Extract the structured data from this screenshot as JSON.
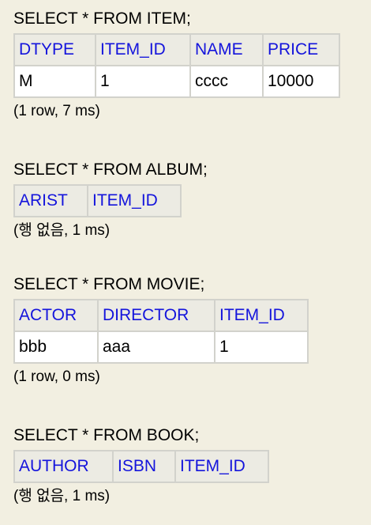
{
  "queries": [
    {
      "sql": "SELECT * FROM ITEM;",
      "columns": [
        "DTYPE",
        "ITEM_ID",
        "NAME",
        "PRICE"
      ],
      "rows": [
        [
          "M",
          "1",
          "cccc",
          "10000"
        ]
      ],
      "summary": "(1 row, 7 ms)"
    },
    {
      "sql": "SELECT * FROM ALBUM;",
      "columns": [
        "ARIST",
        "ITEM_ID"
      ],
      "rows": [],
      "summary": "(행 없음, 1 ms)"
    },
    {
      "sql": "SELECT * FROM MOVIE;",
      "columns": [
        "ACTOR",
        "DIRECTOR",
        "ITEM_ID"
      ],
      "rows": [
        [
          "bbb",
          "aaa",
          "1"
        ]
      ],
      "summary": "(1 row, 0 ms)"
    },
    {
      "sql": "SELECT * FROM BOOK;",
      "columns": [
        "AUTHOR",
        "ISBN",
        "ITEM_ID"
      ],
      "rows": [],
      "summary": "(행 없음, 1 ms)"
    }
  ],
  "colors": {
    "background": "#f2efe1",
    "header_text": "#1414dc",
    "header_bg": "#ecebe3",
    "cell_bg": "#ffffff",
    "border": "#d2d2cc"
  }
}
